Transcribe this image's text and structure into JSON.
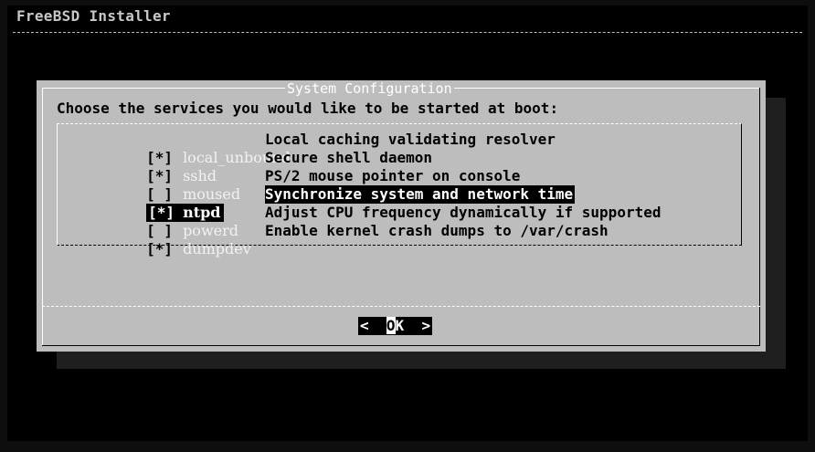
{
  "window": {
    "title": "FreeBSD Installer"
  },
  "dialog": {
    "title": "System Configuration",
    "prompt": "Choose the services you would like to be started at boot:",
    "services": [
      {
        "checkbox": "[*]",
        "name": "local_unbound",
        "description": "Local caching validating resolver",
        "checked": true,
        "selected": false
      },
      {
        "checkbox": "[*]",
        "name": "sshd",
        "description": "Secure shell daemon",
        "checked": true,
        "selected": false
      },
      {
        "checkbox": "[ ]",
        "name": "moused",
        "description": "PS/2 mouse pointer on console",
        "checked": false,
        "selected": false
      },
      {
        "checkbox": "[*]",
        "name": "ntpd",
        "description": "Synchronize system and network time",
        "checked": true,
        "selected": true
      },
      {
        "checkbox": "[ ]",
        "name": "powerd",
        "description": "Adjust CPU frequency dynamically if supported",
        "checked": false,
        "selected": false
      },
      {
        "checkbox": "[*]",
        "name": "dumpdev",
        "description": "Enable kernel crash dumps to /var/crash",
        "checked": true,
        "selected": false
      }
    ],
    "ok_button": {
      "left": "<  ",
      "hotkey": "O",
      "rest": "K  >"
    }
  },
  "colors": {
    "screen_bg": "#000000",
    "dialog_bg": "#bdbdbd",
    "highlight_bg": "#000000",
    "highlight_fg": "#ffffff"
  }
}
